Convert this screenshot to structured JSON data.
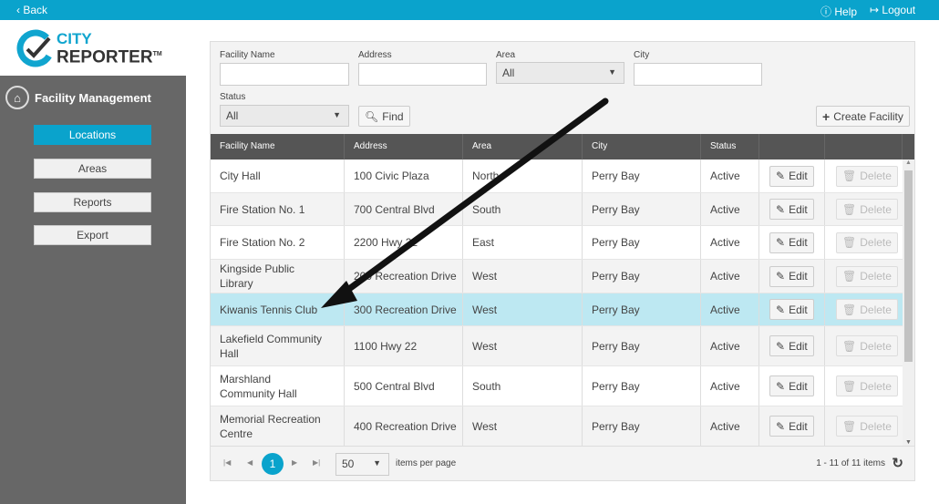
{
  "topbar": {
    "back": "Back",
    "help": "Help",
    "logout": "Logout"
  },
  "logo": {
    "line1": "CITY",
    "line2": "REPORTER",
    "tm": "TM"
  },
  "sidebar": {
    "title": "Facility Management",
    "items": [
      {
        "label": "Locations",
        "active": true
      },
      {
        "label": "Areas"
      },
      {
        "label": "Reports"
      },
      {
        "label": "Export"
      }
    ]
  },
  "filters": {
    "facility_name_label": "Facility Name",
    "address_label": "Address",
    "area_label": "Area",
    "area_value": "All",
    "city_label": "City",
    "status_label": "Status",
    "status_value": "All",
    "find": "Find",
    "create": "Create Facility"
  },
  "table": {
    "columns": [
      "Facility Name",
      "Address",
      "Area",
      "City",
      "Status"
    ],
    "edit": "Edit",
    "delete": "Delete",
    "highlight_color": "#bde8f2",
    "rows": [
      [
        "City Hall",
        "100 Civic Plaza",
        "North",
        "Perry Bay",
        "Active"
      ],
      [
        "Fire Station No. 1",
        "700 Central Blvd",
        "South",
        "Perry Bay",
        "Active"
      ],
      [
        "Fire Station No. 2",
        "2200 Hwy 22",
        "East",
        "Perry Bay",
        "Active"
      ],
      [
        "Kingside Public Library",
        "200 Recreation Drive",
        "West",
        "Perry Bay",
        "Active"
      ],
      [
        "Kiwanis Tennis Club",
        "300 Recreation Drive",
        "West",
        "Perry Bay",
        "Active"
      ],
      [
        "Lakefield Community Hall",
        "1100 Hwy 22",
        "West",
        "Perry Bay",
        "Active"
      ],
      [
        "Marshland Community Hall",
        "500 Central Blvd",
        "South",
        "Perry Bay",
        "Active"
      ],
      [
        "Memorial Recreation Centre",
        "400 Recreation Drive",
        "West",
        "Perry Bay",
        "Active"
      ]
    ]
  },
  "pager": {
    "page": "1",
    "page_size": "50",
    "items_per_page": "items per page",
    "summary": "1 - 11 of 11 items"
  },
  "accent": "#0aa3cc"
}
